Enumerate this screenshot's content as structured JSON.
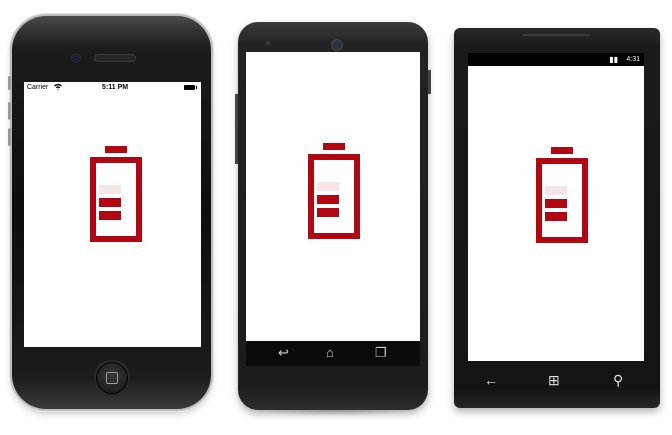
{
  "colors": {
    "battery_red": "#b00712",
    "battery_empty": "#f6e6e8",
    "screen_bg": "#ffffff"
  },
  "devices": {
    "ios": {
      "status": {
        "carrier": "Carrier",
        "wifi_icon": "wifi-icon",
        "time": "5:11 PM",
        "battery_icon": "battery-full-icon"
      },
      "battery": {
        "total_segments": 3,
        "filled_segments": 2
      }
    },
    "android": {
      "nav": {
        "back_icon": "back-icon",
        "home_icon": "home-icon",
        "recents_icon": "recents-icon",
        "back": "↩",
        "home": "⌂",
        "recents": "❐"
      },
      "battery": {
        "total_segments": 3,
        "filled_segments": 2
      }
    },
    "windows": {
      "status": {
        "time": "4:31",
        "icons": "▮▮"
      },
      "nav": {
        "back": "←",
        "start": "⊞",
        "search": "⚲"
      },
      "battery": {
        "total_segments": 3,
        "filled_segments": 2
      }
    }
  }
}
